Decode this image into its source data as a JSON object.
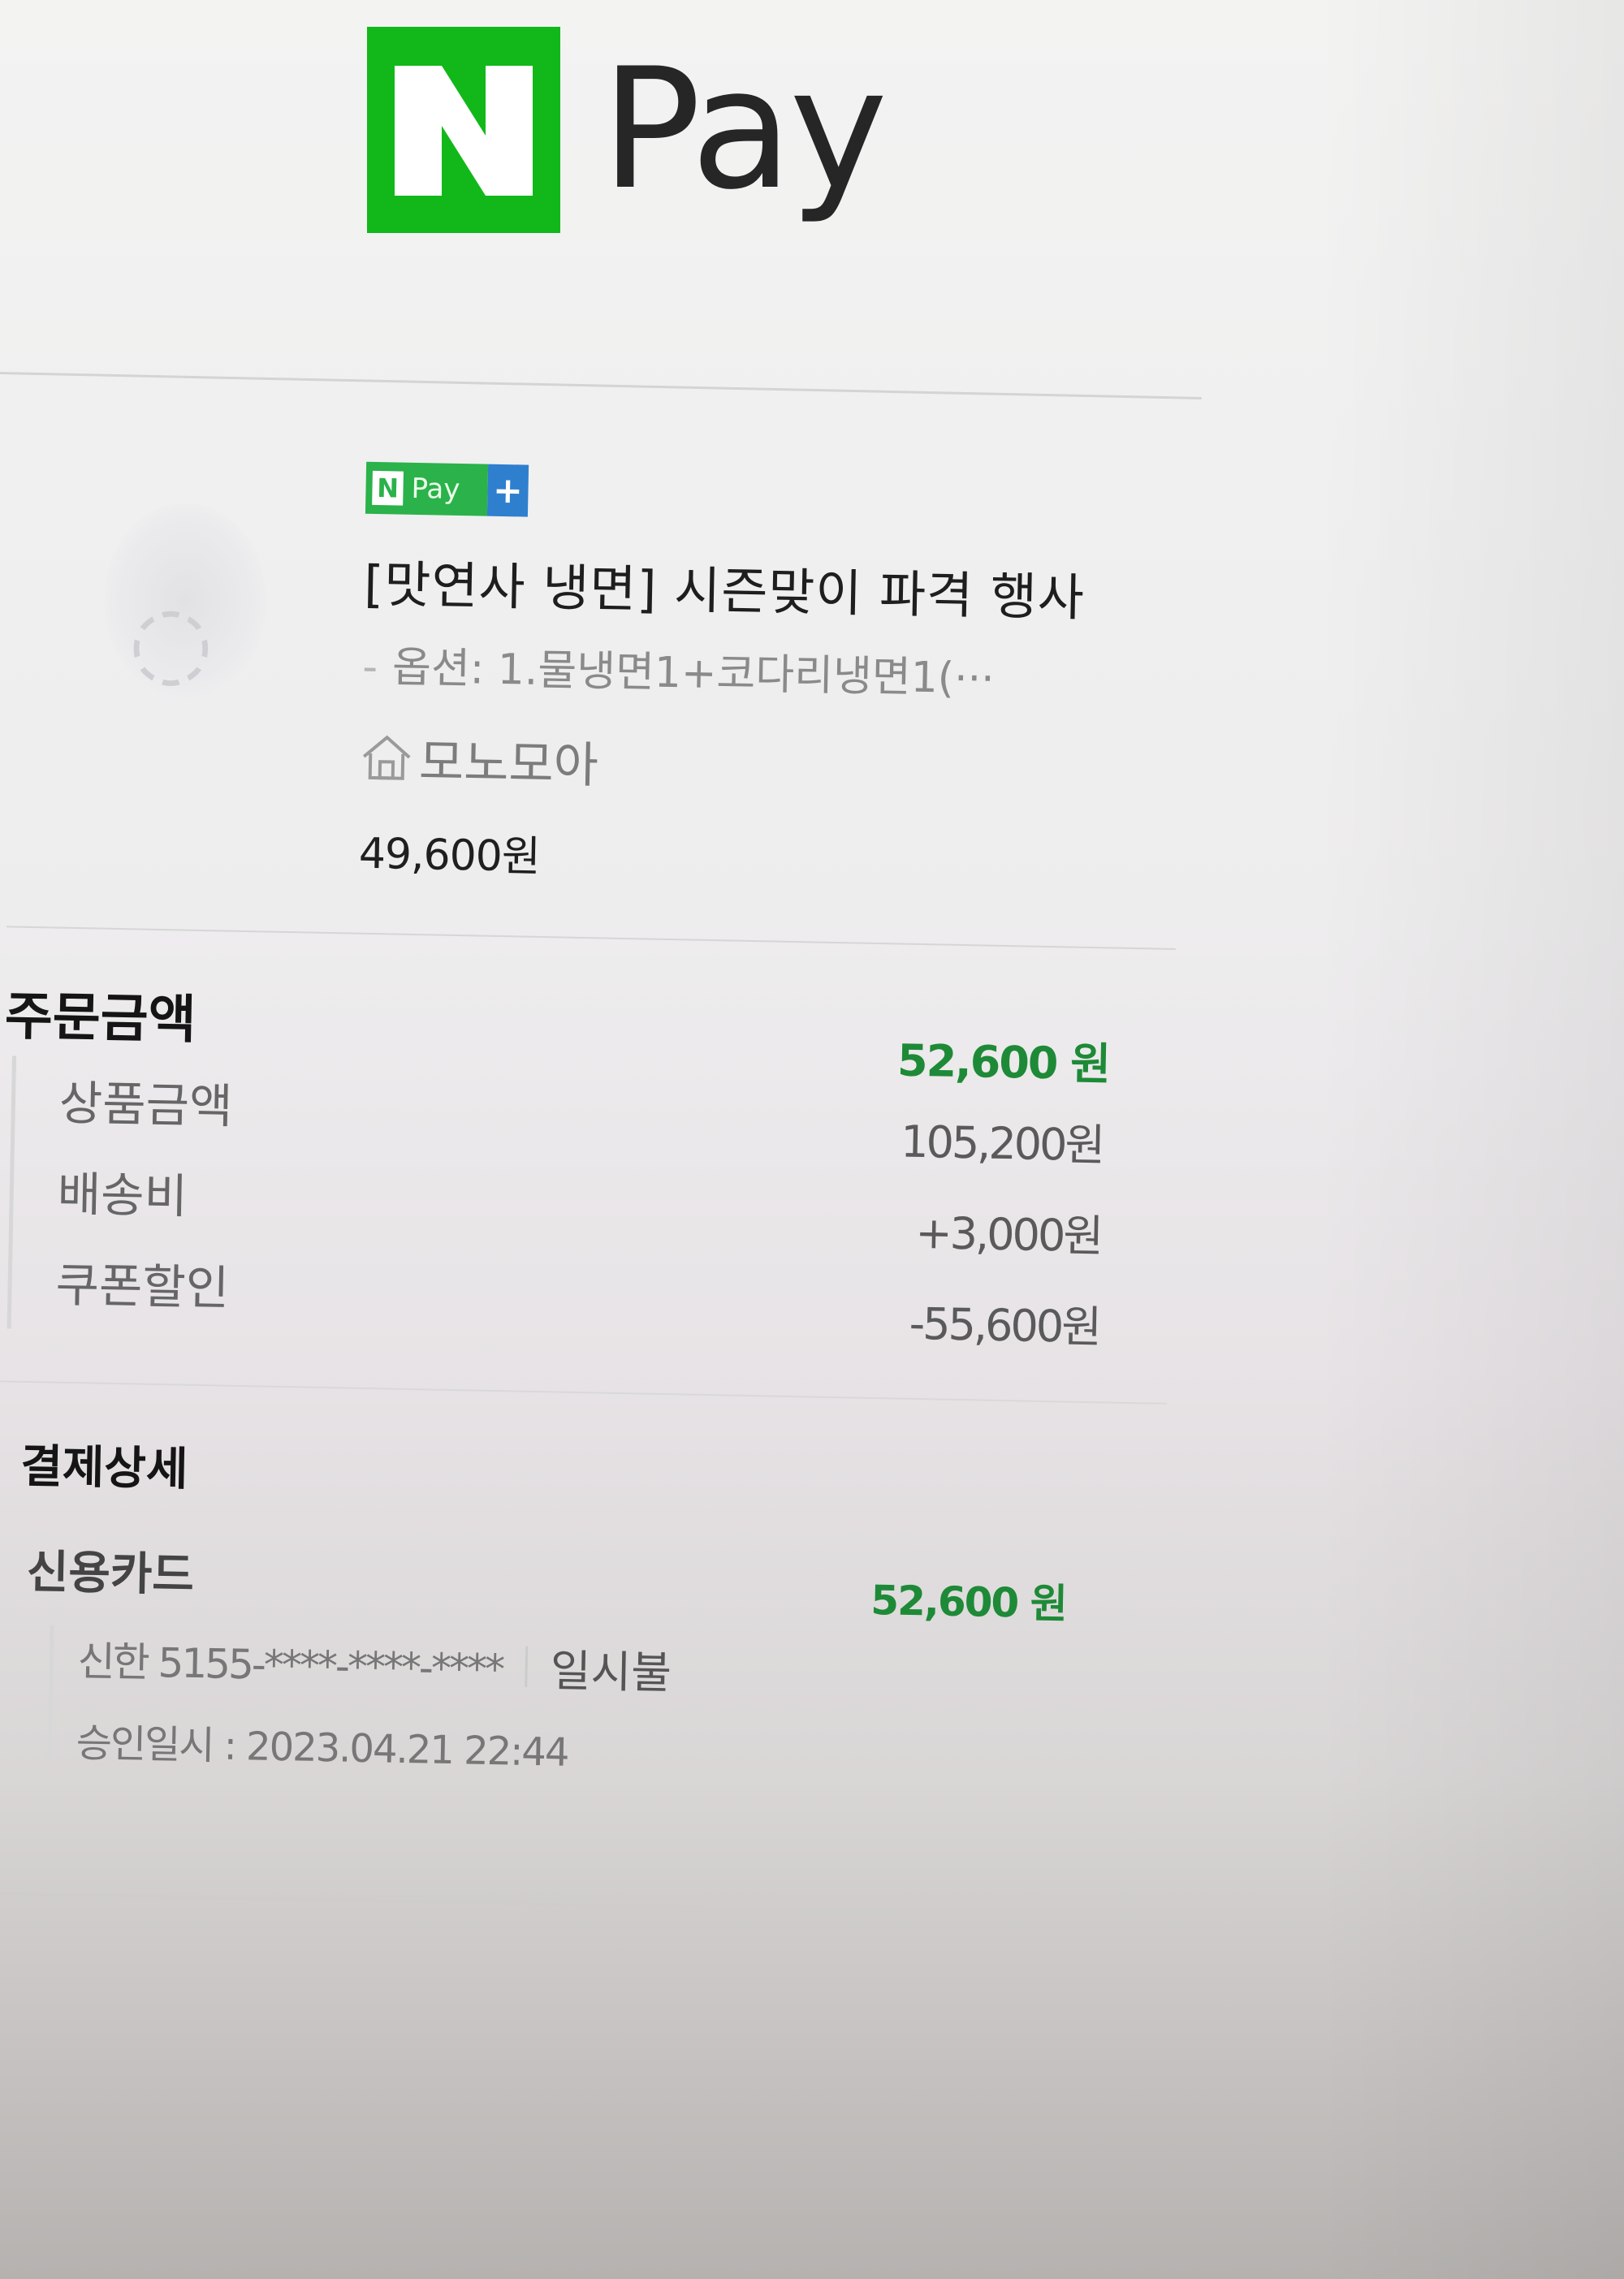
{
  "logo": {
    "letter": "N",
    "text": "Pay",
    "brand_green": "#12b81a"
  },
  "product": {
    "badge": {
      "letter": "N",
      "text": "Pay",
      "plus": "+",
      "green": "#2bb24a",
      "blue": "#2f7fcf"
    },
    "title": "[맛연사 냉면] 시즌맞이 파격 행사",
    "option_prefix": "-",
    "option": "옵션: 1.물냉면1+코다리냉면1(···",
    "store_icon": "home-icon",
    "store_name": "모노모아",
    "price": "49,600원"
  },
  "order_amount": {
    "title": "주문금액",
    "total": "52,600 원",
    "items": [
      {
        "label": "상품금액",
        "value": "105,200원"
      },
      {
        "label": "배송비",
        "value": "+3,000원"
      },
      {
        "label": "쿠폰할인",
        "value": "-55,600원"
      }
    ]
  },
  "payment_detail": {
    "title": "결제상세",
    "method": "신용카드",
    "amount": "52,600 원",
    "card": "신한 5155-****-****-****",
    "installment": "일시불",
    "approval": "승인일시 : 2023.04.21 22:44"
  },
  "colors": {
    "accent_green": "#1e8a37"
  }
}
